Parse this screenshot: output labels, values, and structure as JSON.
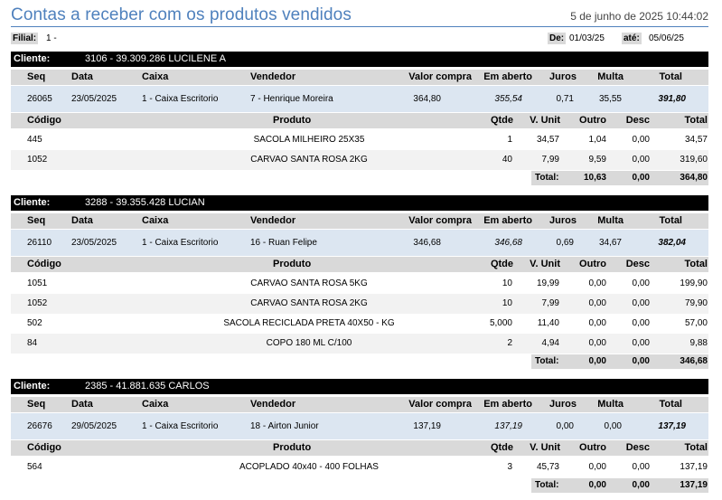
{
  "header": {
    "title": "Contas a receber com os produtos vendidos",
    "date": "5 de junho de 2025 10:44:02"
  },
  "filters": {
    "filial_label": "Filial:",
    "filial_value": "1 -",
    "de_label": "De:",
    "de_value": "01/03/25",
    "ate_label": "até:",
    "ate_value": "05/06/25"
  },
  "labels": {
    "cliente": "Cliente:",
    "seq": "Seq",
    "data": "Data",
    "caixa": "Caixa",
    "vendedor": "Vendedor",
    "valor_compra": "Valor compra",
    "em_aberto": "Em aberto",
    "juros": "Juros",
    "multa": "Multa",
    "total": "Total",
    "codigo": "Código",
    "produto": "Produto",
    "qtde": "Qtde",
    "v_unit": "V. Unit",
    "outro": "Outro",
    "desc": "Desc",
    "total_footer": "Total:"
  },
  "clients": [
    {
      "name": "3106 - 39.309.286 LUCILENE A",
      "seq": "26065",
      "data": "23/05/2025",
      "caixa": "1 - Caixa Escritorio",
      "vendedor": "7 - Henrique Moreira",
      "valor_compra": "364,80",
      "em_aberto": "355,54",
      "juros": "0,71",
      "multa": "35,55",
      "total": "391,80",
      "items": [
        {
          "codigo": "445",
          "produto": "SACOLA MILHEIRO 25X35",
          "qtde": "1",
          "v_unit": "34,57",
          "outro": "1,04",
          "desc": "0,00",
          "total": "34,57"
        },
        {
          "codigo": "1052",
          "produto": "CARVAO SANTA ROSA 2KG",
          "qtde": "40",
          "v_unit": "7,99",
          "outro": "9,59",
          "desc": "0,00",
          "total": "319,60"
        }
      ],
      "footer": {
        "outro": "10,63",
        "desc": "0,00",
        "total": "364,80"
      }
    },
    {
      "name": "3288 - 39.355.428 LUCIAN",
      "seq": "26110",
      "data": "23/05/2025",
      "caixa": "1 - Caixa Escritorio",
      "vendedor": "16 - Ruan Felipe",
      "valor_compra": "346,68",
      "em_aberto": "346,68",
      "juros": "0,69",
      "multa": "34,67",
      "total": "382,04",
      "items": [
        {
          "codigo": "1051",
          "produto": "CARVAO SANTA ROSA 5KG",
          "qtde": "10",
          "v_unit": "19,99",
          "outro": "0,00",
          "desc": "0,00",
          "total": "199,90"
        },
        {
          "codigo": "1052",
          "produto": "CARVAO SANTA ROSA 2KG",
          "qtde": "10",
          "v_unit": "7,99",
          "outro": "0,00",
          "desc": "0,00",
          "total": "79,90"
        },
        {
          "codigo": "502",
          "produto": "SACOLA RECICLADA PRETA 40X50 - KG",
          "qtde": "5,000",
          "v_unit": "11,40",
          "outro": "0,00",
          "desc": "0,00",
          "total": "57,00"
        },
        {
          "codigo": "84",
          "produto": "COPO 180 ML C/100",
          "qtde": "2",
          "v_unit": "4,94",
          "outro": "0,00",
          "desc": "0,00",
          "total": "9,88"
        }
      ],
      "footer": {
        "outro": "0,00",
        "desc": "0,00",
        "total": "346,68"
      }
    },
    {
      "name": "2385 - 41.881.635 CARLOS",
      "seq": "26676",
      "data": "29/05/2025",
      "caixa": "1 - Caixa Escritorio",
      "vendedor": "18 - Airton Junior",
      "valor_compra": "137,19",
      "em_aberto": "137,19",
      "juros": "0,00",
      "multa": "0,00",
      "total": "137,19",
      "items": [
        {
          "codigo": "564",
          "produto": "ACOPLADO 40x40 - 400 FOLHAS",
          "qtde": "3",
          "v_unit": "45,73",
          "outro": "0,00",
          "desc": "0,00",
          "total": "137,19"
        }
      ],
      "footer": {
        "outro": "0,00",
        "desc": "0,00",
        "total": "137,19"
      }
    }
  ]
}
